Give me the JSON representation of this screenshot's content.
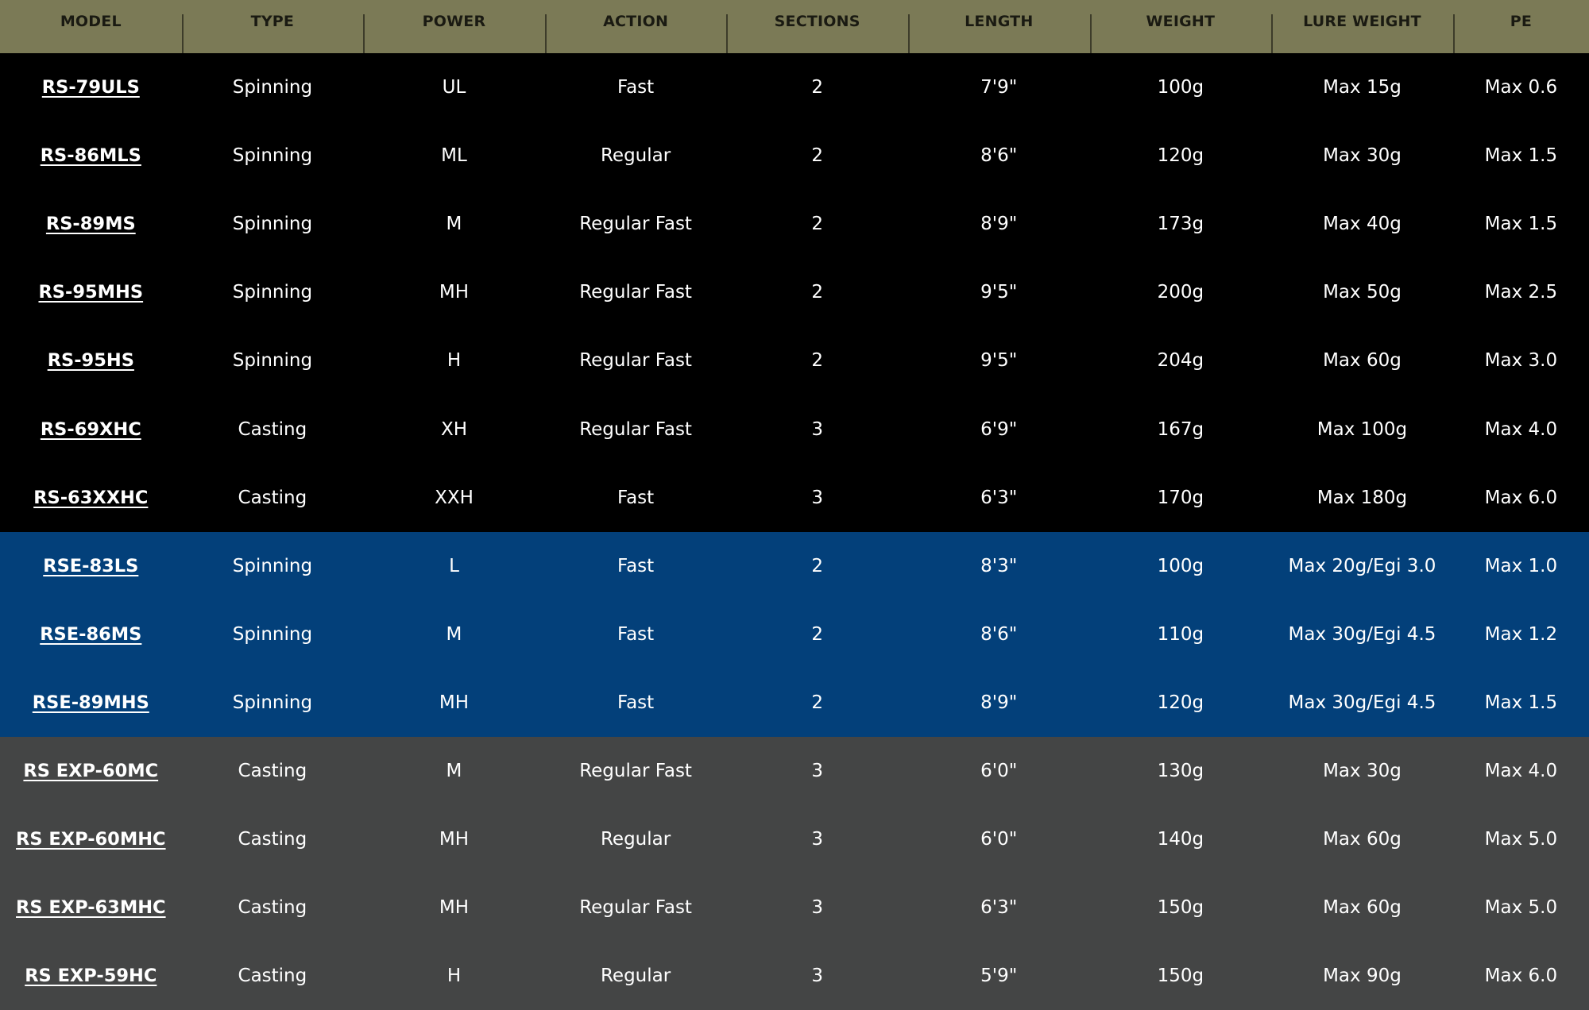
{
  "table": {
    "headers": [
      "MODEL",
      "TYPE",
      "POWER",
      "ACTION",
      "SECTIONS",
      "LENGTH",
      "WEIGHT",
      "LURE WEIGHT",
      "PE"
    ],
    "rows": [
      {
        "group": "rs",
        "cells": [
          "RS-79ULS",
          "Spinning",
          "UL",
          "Fast",
          "2",
          "7'9\"",
          "100g",
          "Max 15g",
          "Max 0.6"
        ]
      },
      {
        "group": "rs",
        "cells": [
          "RS-86MLS",
          "Spinning",
          "ML",
          "Regular",
          "2",
          "8'6\"",
          "120g",
          "Max 30g",
          "Max 1.5"
        ]
      },
      {
        "group": "rs",
        "cells": [
          "RS-89MS",
          "Spinning",
          "M",
          "Regular Fast",
          "2",
          "8'9\"",
          "173g",
          "Max 40g",
          "Max 1.5"
        ]
      },
      {
        "group": "rs",
        "cells": [
          "RS-95MHS",
          "Spinning",
          "MH",
          "Regular Fast",
          "2",
          "9'5\"",
          "200g",
          "Max 50g",
          "Max 2.5"
        ]
      },
      {
        "group": "rs",
        "cells": [
          "RS-95HS",
          "Spinning",
          "H",
          "Regular Fast",
          "2",
          "9'5\"",
          "204g",
          "Max 60g",
          "Max 3.0"
        ]
      },
      {
        "group": "rs",
        "cells": [
          "RS-69XHC",
          "Casting",
          "XH",
          "Regular Fast",
          "3",
          "6'9\"",
          "167g",
          "Max 100g",
          "Max 4.0"
        ]
      },
      {
        "group": "rs",
        "cells": [
          "RS-63XXHC",
          "Casting",
          "XXH",
          "Fast",
          "3",
          "6'3\"",
          "170g",
          "Max 180g",
          "Max 6.0"
        ]
      },
      {
        "group": "rse",
        "cells": [
          "RSE-83LS",
          "Spinning",
          "L",
          "Fast",
          "2",
          "8'3\"",
          "100g",
          "Max 20g/Egi 3.0",
          "Max 1.0"
        ]
      },
      {
        "group": "rse",
        "cells": [
          "RSE-86MS",
          "Spinning",
          "M",
          "Fast",
          "2",
          "8'6\"",
          "110g",
          "Max 30g/Egi 4.5",
          "Max 1.2"
        ]
      },
      {
        "group": "rse",
        "cells": [
          "RSE-89MHS",
          "Spinning",
          "MH",
          "Fast",
          "2",
          "8'9\"",
          "120g",
          "Max 30g/Egi 4.5",
          "Max 1.5"
        ]
      },
      {
        "group": "exp",
        "cells": [
          "RS EXP-60MC",
          "Casting",
          "M",
          "Regular Fast",
          "3",
          "6'0\"",
          "130g",
          "Max 30g",
          "Max 4.0"
        ]
      },
      {
        "group": "exp",
        "cells": [
          "RS EXP-60MHC",
          "Casting",
          "MH",
          "Regular",
          "3",
          "6'0\"",
          "140g",
          "Max 60g",
          "Max 5.0"
        ]
      },
      {
        "group": "exp",
        "cells": [
          "RS EXP-63MHC",
          "Casting",
          "MH",
          "Regular Fast",
          "3",
          "6'3\"",
          "150g",
          "Max 60g",
          "Max 5.0"
        ]
      },
      {
        "group": "exp",
        "cells": [
          "RS EXP-59HC",
          "Casting",
          "H",
          "Regular",
          "3",
          "5'9\"",
          "150g",
          "Max 90g",
          "Max 6.0"
        ]
      }
    ]
  },
  "colors": {
    "header_bg": "#7b7a56",
    "header_text": "#1a1a12",
    "group_rs_bg": "#000000",
    "group_rse_bg": "#03407a",
    "group_exp_bg": "#444545",
    "text": "#ffffff"
  }
}
